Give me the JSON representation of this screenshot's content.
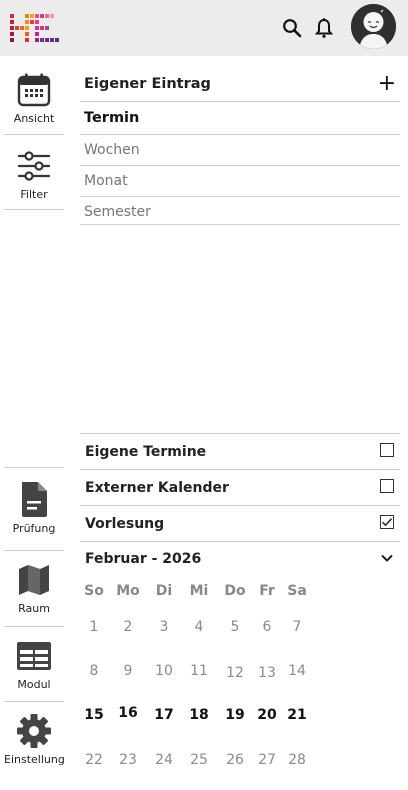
{
  "header": {
    "logo_icon": "hfe-logo-icon",
    "search_icon": "search-icon",
    "bell_icon": "bell-icon",
    "avatar_icon": "avatar-icon"
  },
  "sidebar": {
    "top_items": [
      {
        "label": "Ansicht",
        "icon": "calendar-icon"
      },
      {
        "label": "Filter",
        "icon": "sliders-icon"
      }
    ],
    "bottom_items": [
      {
        "label": "Prüfung",
        "icon": "document-icon"
      },
      {
        "label": "Raum",
        "icon": "map-icon"
      },
      {
        "label": "Modul",
        "icon": "table-icon"
      },
      {
        "label": "Einstellung",
        "icon": "gear-icon"
      }
    ]
  },
  "view": {
    "own_entry": "Eigener Eintrag",
    "add_icon": "plus-icon",
    "options": [
      "Termin",
      "Wochen",
      "Monat",
      "Semester"
    ],
    "selected": "Termin"
  },
  "filters": [
    {
      "label": "Eigene Termine",
      "checked": false
    },
    {
      "label": "Externer Kalender",
      "checked": false
    },
    {
      "label": "Vorlesung",
      "checked": true
    }
  ],
  "calendar": {
    "month_label": "Februar - 2026",
    "chevron_icon": "chevron-down-icon",
    "weekdays": [
      "So",
      "Mo",
      "Di",
      "Mi",
      "Do",
      "Fr",
      "Sa"
    ],
    "weeks": [
      [
        "1",
        "2",
        "3",
        "4",
        "5",
        "6",
        "7"
      ],
      [
        "8",
        "9",
        "10",
        "11",
        "12",
        "13",
        "14"
      ],
      [
        "15",
        "16",
        "17",
        "18",
        "19",
        "20",
        "21"
      ],
      [
        "22",
        "23",
        "24",
        "25",
        "26",
        "27",
        "28"
      ]
    ],
    "current_week_index": 2
  },
  "colors": {
    "topbar": "#ececec",
    "separator": "#cfcfcf",
    "muted_text": "#777777"
  }
}
